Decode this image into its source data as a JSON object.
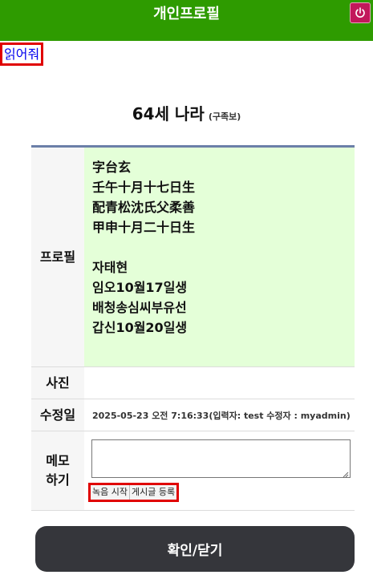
{
  "header": {
    "title": "개인프로필",
    "power_icon": "power-icon"
  },
  "read_link": "읽어줘",
  "person": {
    "name": "64세 나라",
    "relation": "(구족보)"
  },
  "table": {
    "profile_label": "프로필",
    "profile_lines_hanja": [
      "字台玄",
      "壬午十月十七日生",
      "配青松沈氏父柔善",
      "甲申十月二十日生"
    ],
    "profile_lines_hangul": [
      "자태현",
      "임오10월17일생",
      "배청송심씨부유선",
      "갑신10월20일생"
    ],
    "photo_label": "사진",
    "modified_label": "수정일",
    "modified_value": "2025-05-23 오전 7:16:33(입력자: test 수정자 : myadmin)",
    "memo_label": "메모하기",
    "memo_value": "",
    "record_button": "녹음 시작",
    "post_button": "게시글 등록"
  },
  "confirm_button": "확인/닫기",
  "colors": {
    "header": "#2e9b00",
    "profile_bg": "#e4ffd8",
    "highlight": "#e00000",
    "button": "#35363b"
  }
}
